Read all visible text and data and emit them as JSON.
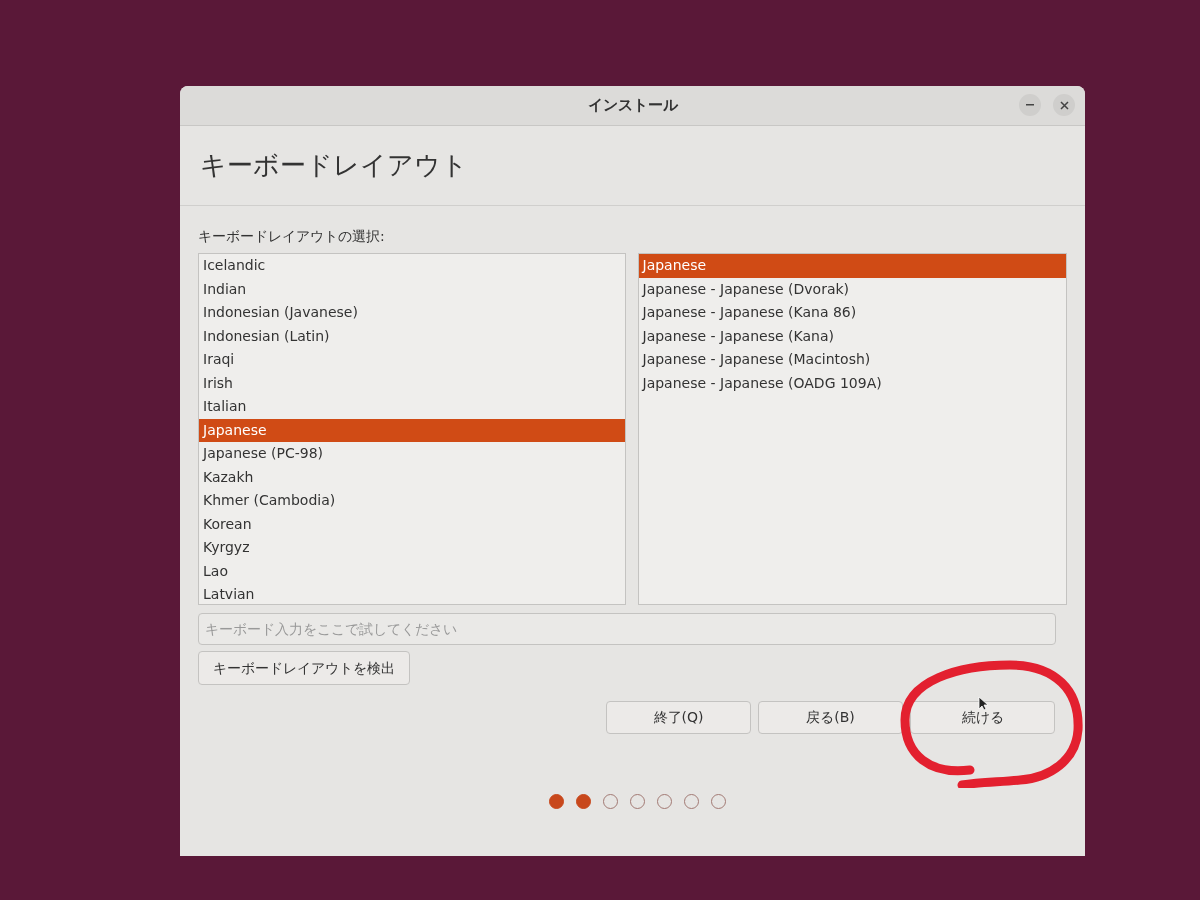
{
  "window": {
    "title": "インストール"
  },
  "heading": "キーボードレイアウト",
  "layout_label": "キーボードレイアウトの選択:",
  "layouts": [
    {
      "label": "Icelandic",
      "selected": false
    },
    {
      "label": "Indian",
      "selected": false
    },
    {
      "label": "Indonesian (Javanese)",
      "selected": false
    },
    {
      "label": "Indonesian (Latin)",
      "selected": false
    },
    {
      "label": "Iraqi",
      "selected": false
    },
    {
      "label": "Irish",
      "selected": false
    },
    {
      "label": "Italian",
      "selected": false
    },
    {
      "label": "Japanese",
      "selected": true
    },
    {
      "label": "Japanese (PC-98)",
      "selected": false
    },
    {
      "label": "Kazakh",
      "selected": false
    },
    {
      "label": "Khmer (Cambodia)",
      "selected": false
    },
    {
      "label": "Korean",
      "selected": false
    },
    {
      "label": "Kyrgyz",
      "selected": false
    },
    {
      "label": "Lao",
      "selected": false
    },
    {
      "label": "Latvian",
      "selected": false
    }
  ],
  "variants": [
    {
      "label": "Japanese",
      "selected": true
    },
    {
      "label": "Japanese - Japanese (Dvorak)",
      "selected": false
    },
    {
      "label": "Japanese - Japanese (Kana 86)",
      "selected": false
    },
    {
      "label": "Japanese - Japanese (Kana)",
      "selected": false
    },
    {
      "label": "Japanese - Japanese (Macintosh)",
      "selected": false
    },
    {
      "label": "Japanese - Japanese (OADG 109A)",
      "selected": false
    }
  ],
  "test_field": {
    "placeholder": "キーボード入力をここで試してください"
  },
  "detect_button": "キーボードレイアウトを検出",
  "buttons": [
    "終了(Q)",
    "戻る(B)",
    "続ける"
  ],
  "progress_dots": [
    {
      "filled": true
    },
    {
      "filled": true
    },
    {
      "filled": false
    },
    {
      "filled": false
    },
    {
      "filled": false
    },
    {
      "filled": false
    },
    {
      "filled": false
    }
  ]
}
